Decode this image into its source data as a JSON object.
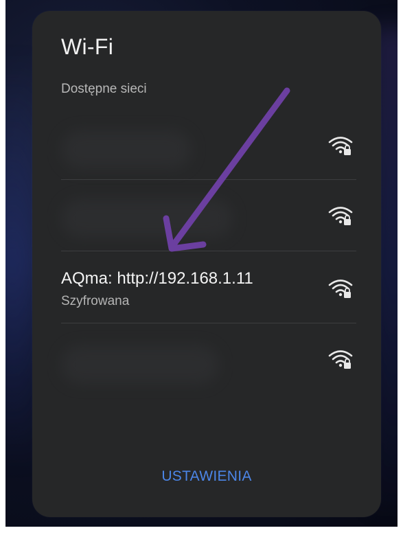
{
  "dialog": {
    "title": "Wi-Fi",
    "section_label": "Dostępne sieci",
    "networks": [
      {
        "name": "",
        "status": "",
        "icon": "wifi-locked-icon"
      },
      {
        "name": "",
        "status": "",
        "icon": "wifi-locked-icon"
      },
      {
        "name": "AQma: http://192.168.1.11",
        "status": "Szyfrowana",
        "icon": "wifi-locked-icon"
      },
      {
        "name": "",
        "status": "",
        "icon": "wifi-locked-icon"
      }
    ],
    "settings_label": "USTAWIENIA"
  },
  "colors": {
    "dialog_bg": "#262728",
    "accent": "#4c86e8",
    "annotation_arrow": "#6b3fa0"
  }
}
